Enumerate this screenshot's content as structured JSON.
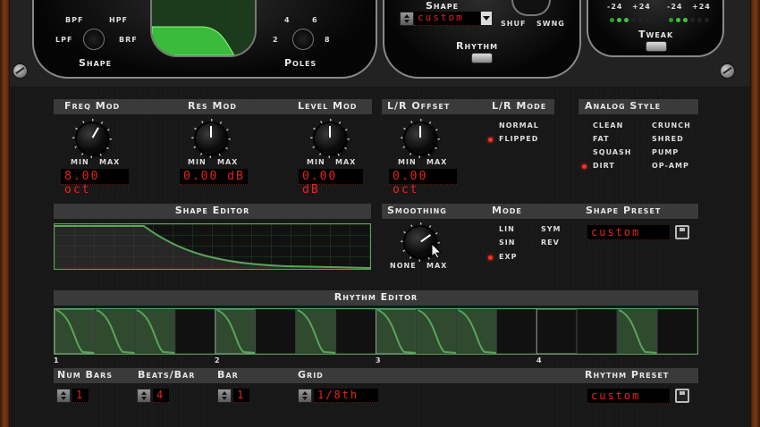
{
  "top": {
    "filter": {
      "bpf": "BPF",
      "hpf": "HPF",
      "lpf": "LPF",
      "brf": "BRF",
      "label": "Shape"
    },
    "poles": {
      "n4": "4",
      "n6": "6",
      "n2": "2",
      "n8": "8",
      "label": "Poles"
    },
    "shape_title": "Shape",
    "shape_value": "custom",
    "shuf": "SHUF",
    "swng": "SWNG",
    "rhythm": "Rhythm",
    "meter_labels": [
      "-24",
      "+24",
      "-24",
      "+24"
    ],
    "tweak": "Tweak"
  },
  "mods": [
    {
      "title": "Freq Mod",
      "min": "MIN",
      "max": "MAX",
      "value": "8.00 oct",
      "rotation_deg": 30
    },
    {
      "title": "Res Mod",
      "min": "MIN",
      "max": "MAX",
      "value": "0.00 dB",
      "rotation_deg": 0
    },
    {
      "title": "Level Mod",
      "min": "MIN",
      "max": "MAX",
      "value": "0.00 dB",
      "rotation_deg": 0
    },
    {
      "title": "L/R Offset",
      "min": "MIN",
      "max": "MAX",
      "value": "0.00 oct",
      "rotation_deg": 0
    }
  ],
  "lr_mode": {
    "title": "L/R Mode",
    "options": [
      "NORMAL",
      "FLIPPED"
    ],
    "selected": "FLIPPED"
  },
  "analog_style": {
    "title": "Analog Style",
    "options": [
      "CLEAN",
      "CRUNCH",
      "FAT",
      "SHRED",
      "SQUASH",
      "PUMP",
      "DIRT",
      "OP-AMP"
    ],
    "selected": "DIRT"
  },
  "shape_editor": {
    "title": "Shape Editor"
  },
  "smoothing": {
    "title": "Smoothing",
    "min": "NONE",
    "max": "MAX",
    "rotation_deg": 55
  },
  "mode": {
    "title": "Mode",
    "options": [
      "LIN",
      "SYM",
      "SIN",
      "REV",
      "EXP"
    ],
    "selected": "EXP"
  },
  "shape_preset": {
    "title": "Shape Preset",
    "value": "custom"
  },
  "rhythm_editor": {
    "title": "Rhythm Editor",
    "bar_numbers": [
      "1",
      "2",
      "3",
      "4"
    ],
    "steps": [
      1,
      1,
      1,
      0,
      1,
      0,
      1,
      0,
      1,
      1,
      1,
      0,
      0,
      0,
      1,
      0
    ]
  },
  "bottom": {
    "num_bars": {
      "label": "Num Bars",
      "value": "1"
    },
    "beats_bar": {
      "label": "Beats/Bar",
      "value": "4"
    },
    "bar": {
      "label": "Bar",
      "value": "1"
    },
    "grid": {
      "label": "Grid",
      "value": "1/8th"
    },
    "rhythm_preset": {
      "label": "Rhythm Preset",
      "value": "custom"
    }
  },
  "colors": {
    "lcd_red": "#e8231d",
    "editor_green": "#5aa35a",
    "led_red": "#ff3020",
    "led_green": "#3cc63c"
  }
}
